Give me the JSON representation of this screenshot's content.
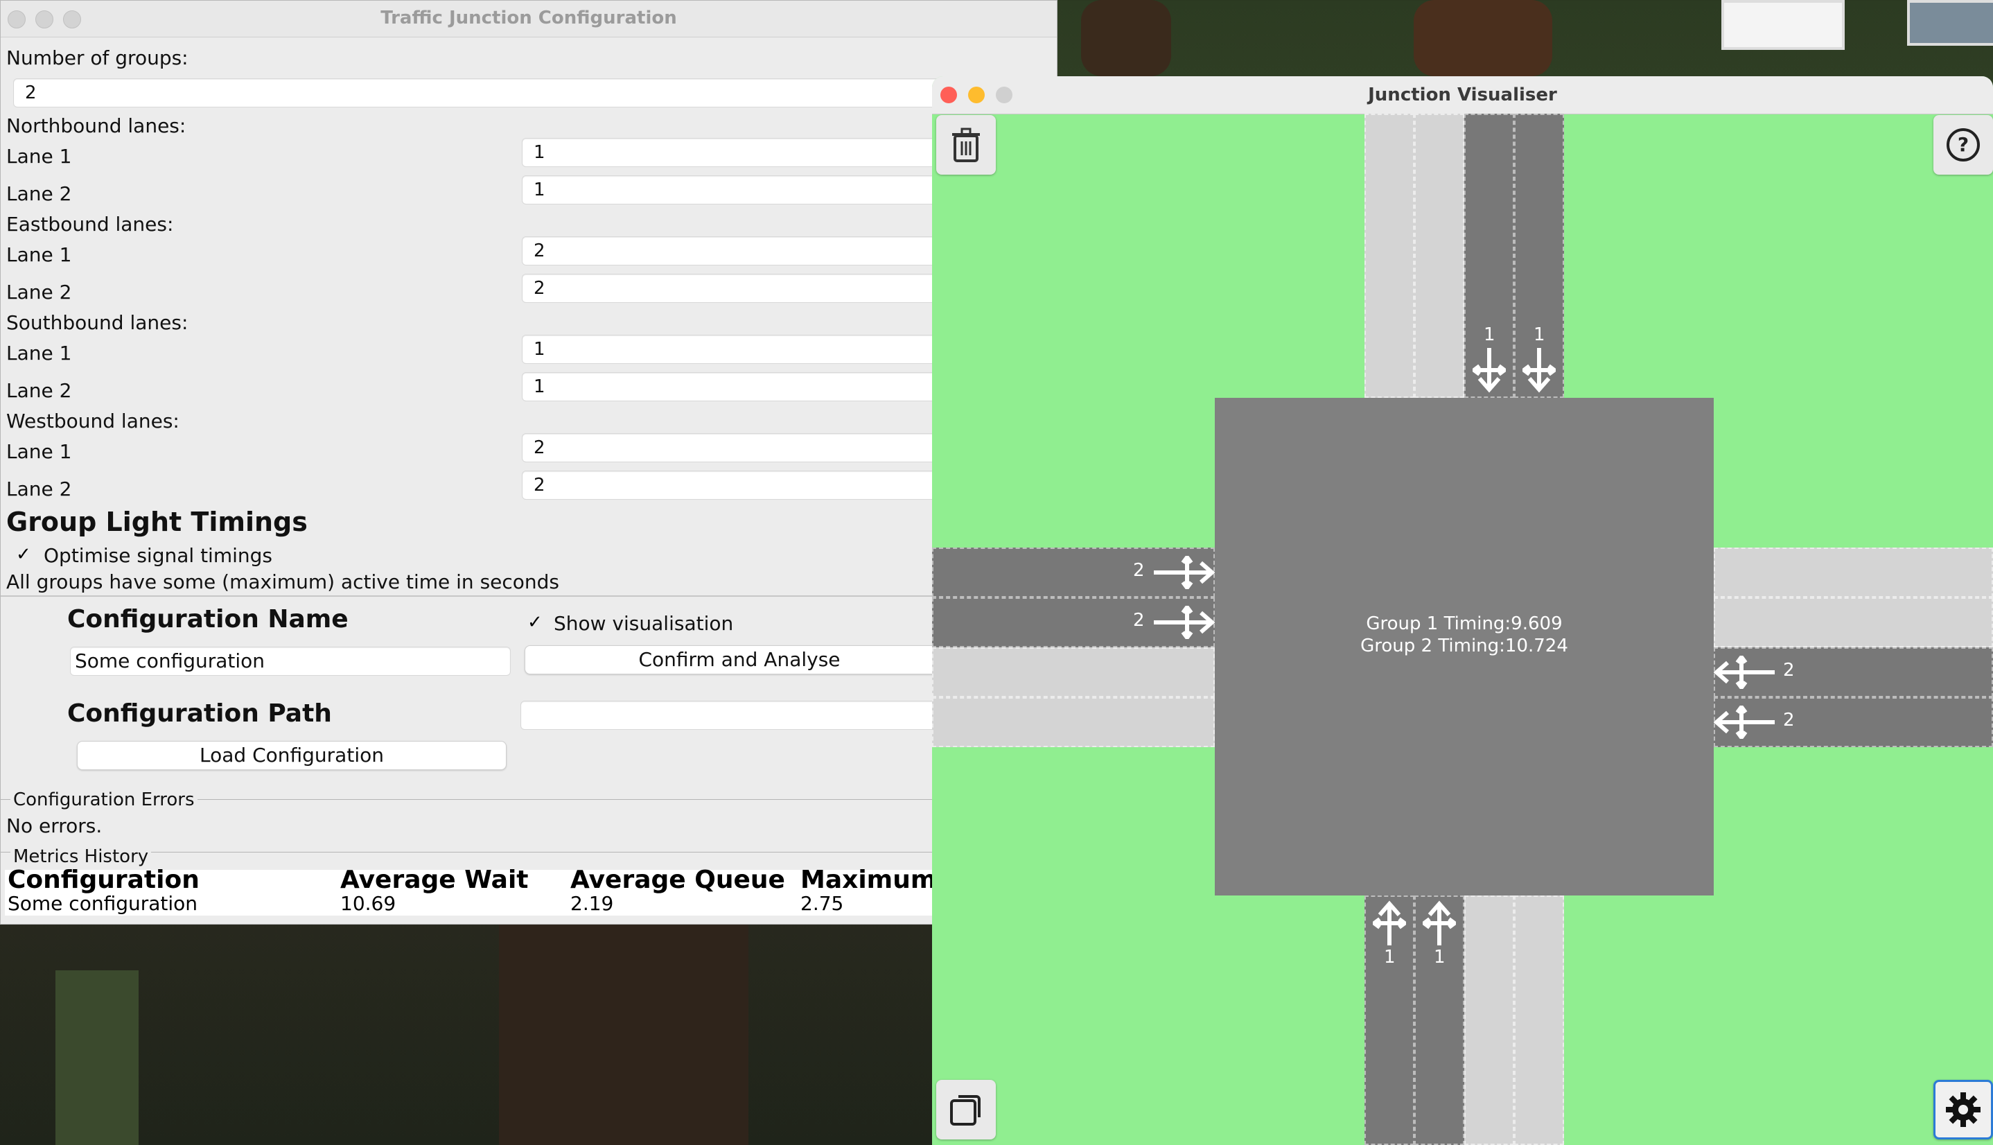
{
  "config_window": {
    "title": "Traffic Junction Configuration",
    "groups_label": "Number of groups:",
    "groups_value": "2",
    "sections": [
      {
        "heading": "Northbound lanes:",
        "lanes": [
          {
            "label": "Lane 1",
            "value": "1"
          },
          {
            "label": "Lane 2",
            "value": "1"
          }
        ]
      },
      {
        "heading": "Eastbound lanes:",
        "lanes": [
          {
            "label": "Lane 1",
            "value": "2"
          },
          {
            "label": "Lane 2",
            "value": "2"
          }
        ]
      },
      {
        "heading": "Southbound lanes:",
        "lanes": [
          {
            "label": "Lane 1",
            "value": "1"
          },
          {
            "label": "Lane 2",
            "value": "1"
          }
        ]
      },
      {
        "heading": "Westbound lanes:",
        "lanes": [
          {
            "label": "Lane 1",
            "value": "2"
          },
          {
            "label": "Lane 2",
            "value": "2"
          }
        ]
      }
    ],
    "timings_heading": "Group Light Timings",
    "optimise_label": "Optimise signal timings",
    "optimise_checked": true,
    "active_time_note": "All groups have some (maximum) active time in seconds",
    "config_name_heading": "Configuration Name",
    "config_name_value": "Some configuration",
    "show_vis_label": "Show visualisation",
    "show_vis_checked": true,
    "confirm_button": "Confirm and Analyse",
    "config_path_heading": "Configuration Path",
    "config_path_value": "",
    "load_button": "Load Configuration",
    "errors_title": "Configuration Errors",
    "errors_text": "No errors.",
    "metrics_title": "Metrics History",
    "metrics_headers": [
      "Configuration",
      "Average Wait",
      "Average Queue",
      "Maximum"
    ],
    "metrics_rows": [
      [
        "Some configuration",
        "10.69",
        "2.19",
        "2.75"
      ]
    ]
  },
  "visualiser": {
    "title": "Junction Visualiser",
    "timing_line1": "Group 1 Timing:9.609",
    "timing_line2": "Group 2 Timing:10.724",
    "north_lane_labels": [
      "1",
      "1"
    ],
    "south_lane_labels": [
      "1",
      "1"
    ],
    "west_lane_labels": [
      "2",
      "2"
    ],
    "east_lane_labels": [
      "2",
      "2"
    ],
    "icons": [
      "trash-icon",
      "help-icon",
      "window-icon",
      "gear-icon"
    ]
  },
  "colors": {
    "grass": "#90ee90",
    "road_dark": "#787878",
    "road_light": "#d4d4d4",
    "junction": "#808080"
  }
}
